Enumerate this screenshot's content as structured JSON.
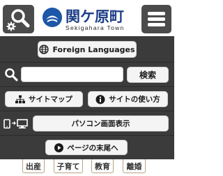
{
  "header": {
    "site_name": "関ケ原町",
    "site_name_romaji": "Sekigahara Town"
  },
  "language_button": {
    "label": "Foreign Languages"
  },
  "search": {
    "value": "",
    "placeholder": "",
    "submit_label": "検索"
  },
  "nav": {
    "sitemap_label": "サイトマップ",
    "howto_label": "サイトの使い方",
    "pc_view_label": "パソコン画面表示",
    "page_end_label": "ページの末尾へ"
  },
  "categories": [
    "出産",
    "子育て",
    "教育",
    "離婚"
  ],
  "colors": {
    "panel": "#3b3b3b",
    "tile": "#4b4b4b",
    "logo": "#1e3f88",
    "button": "#f4f4f4"
  },
  "icons": [
    "search-settings-icon",
    "town-emblem-icon",
    "hamburger-menu-icon",
    "globe-icon",
    "search-icon",
    "sitemap-icon",
    "info-icon",
    "mobile-pc-icon",
    "play-icon"
  ]
}
